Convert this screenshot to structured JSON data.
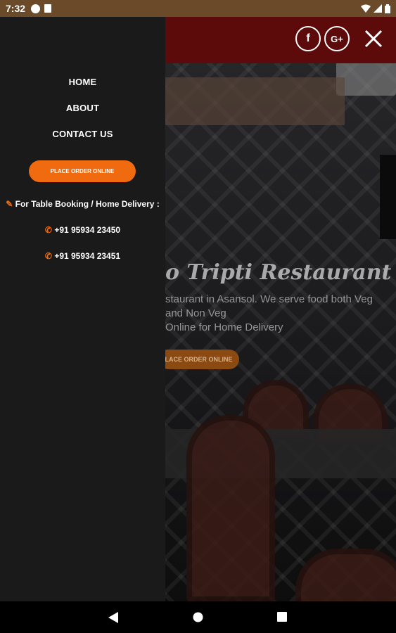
{
  "status_bar": {
    "time": "7:32"
  },
  "header": {
    "facebook_label": "f",
    "googleplus_label": "G+"
  },
  "hero": {
    "title": "o Tripti Restaurant",
    "desc_line1": "staurant in Asansol. We serve food both Veg",
    "desc_line2": "and Non Veg",
    "desc_line3": "Online for Home Delivery",
    "order_button": "LACE ORDER ONLINE"
  },
  "drawer": {
    "nav": [
      {
        "label": "HOME"
      },
      {
        "label": "ABOUT"
      },
      {
        "label": "CONTACT US"
      }
    ],
    "order_button": "PLACE ORDER ONLINE",
    "booking_text": "For Table Booking / Home Delivery :",
    "phones": [
      "+91 95934 23450",
      "+91 95934 23451"
    ]
  },
  "colors": {
    "accent": "#f06a0f",
    "header_bg": "#5c0a0a",
    "drawer_bg": "#1a1a1a",
    "status_bg": "#6b4a2a"
  }
}
